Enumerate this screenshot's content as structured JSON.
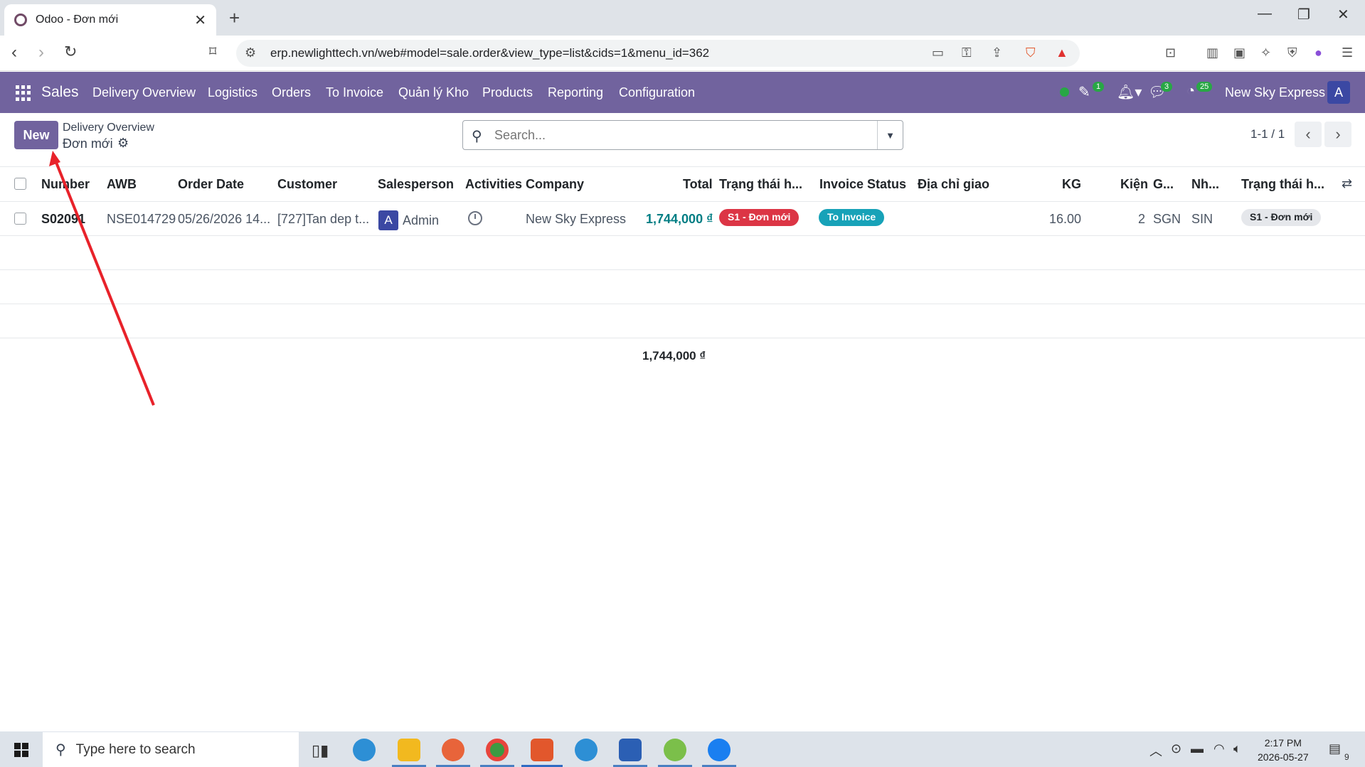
{
  "browser": {
    "tab_title": "Odoo - Đơn mới",
    "url": "erp.newlighttech.vn/web#model=sale.order&view_type=list&cids=1&menu_id=362"
  },
  "navbar": {
    "brand": "Sales",
    "menu": [
      "Delivery Overview",
      "Logistics",
      "Orders",
      "To Invoice",
      "Quản lý Kho",
      "Products",
      "Reporting",
      "Configuration"
    ],
    "badges": {
      "activities": "1",
      "messages": "3",
      "timer": "25"
    },
    "company": "New Sky Express",
    "avatar": "A"
  },
  "control": {
    "new_label": "New",
    "breadcrumb_parent": "Delivery Overview",
    "breadcrumb_current": "Đơn mới",
    "search_placeholder": "Search...",
    "pager": "1-1 / 1"
  },
  "table": {
    "headers": [
      "Number",
      "AWB",
      "Order Date",
      "Customer",
      "Salesperson",
      "Activities",
      "Company",
      "Total",
      "Trạng thái h...",
      "Invoice Status",
      "Địa chỉ giao",
      "KG",
      "Kiện",
      "G...",
      "Nh...",
      "Trạng thái h..."
    ],
    "rows": [
      {
        "number": "S02091",
        "awb": "NSE014729",
        "order_date": "05/26/2026 14...",
        "customer": "[727]Tan dep t...",
        "salesperson_avatar": "A",
        "salesperson": "Admin",
        "company": "New Sky Express",
        "total": "1,744,000 ₫",
        "status1": "S1 - Đơn mới",
        "invoice_status": "To Invoice",
        "kg": "16.00",
        "kien": "2",
        "g": "SGN",
        "nh": "SIN",
        "status2": "S1 - Đơn mới"
      }
    ],
    "sum_total": "1,744,000 ₫"
  },
  "taskbar": {
    "search_text": "Type here to search",
    "time": "2:17 PM",
    "date": "2026-05-27",
    "notifications": "9"
  },
  "colors": {
    "odoo_purple": "#71639e",
    "danger": "#dc3545",
    "info": "#17a2b8",
    "link": "#017e84"
  }
}
